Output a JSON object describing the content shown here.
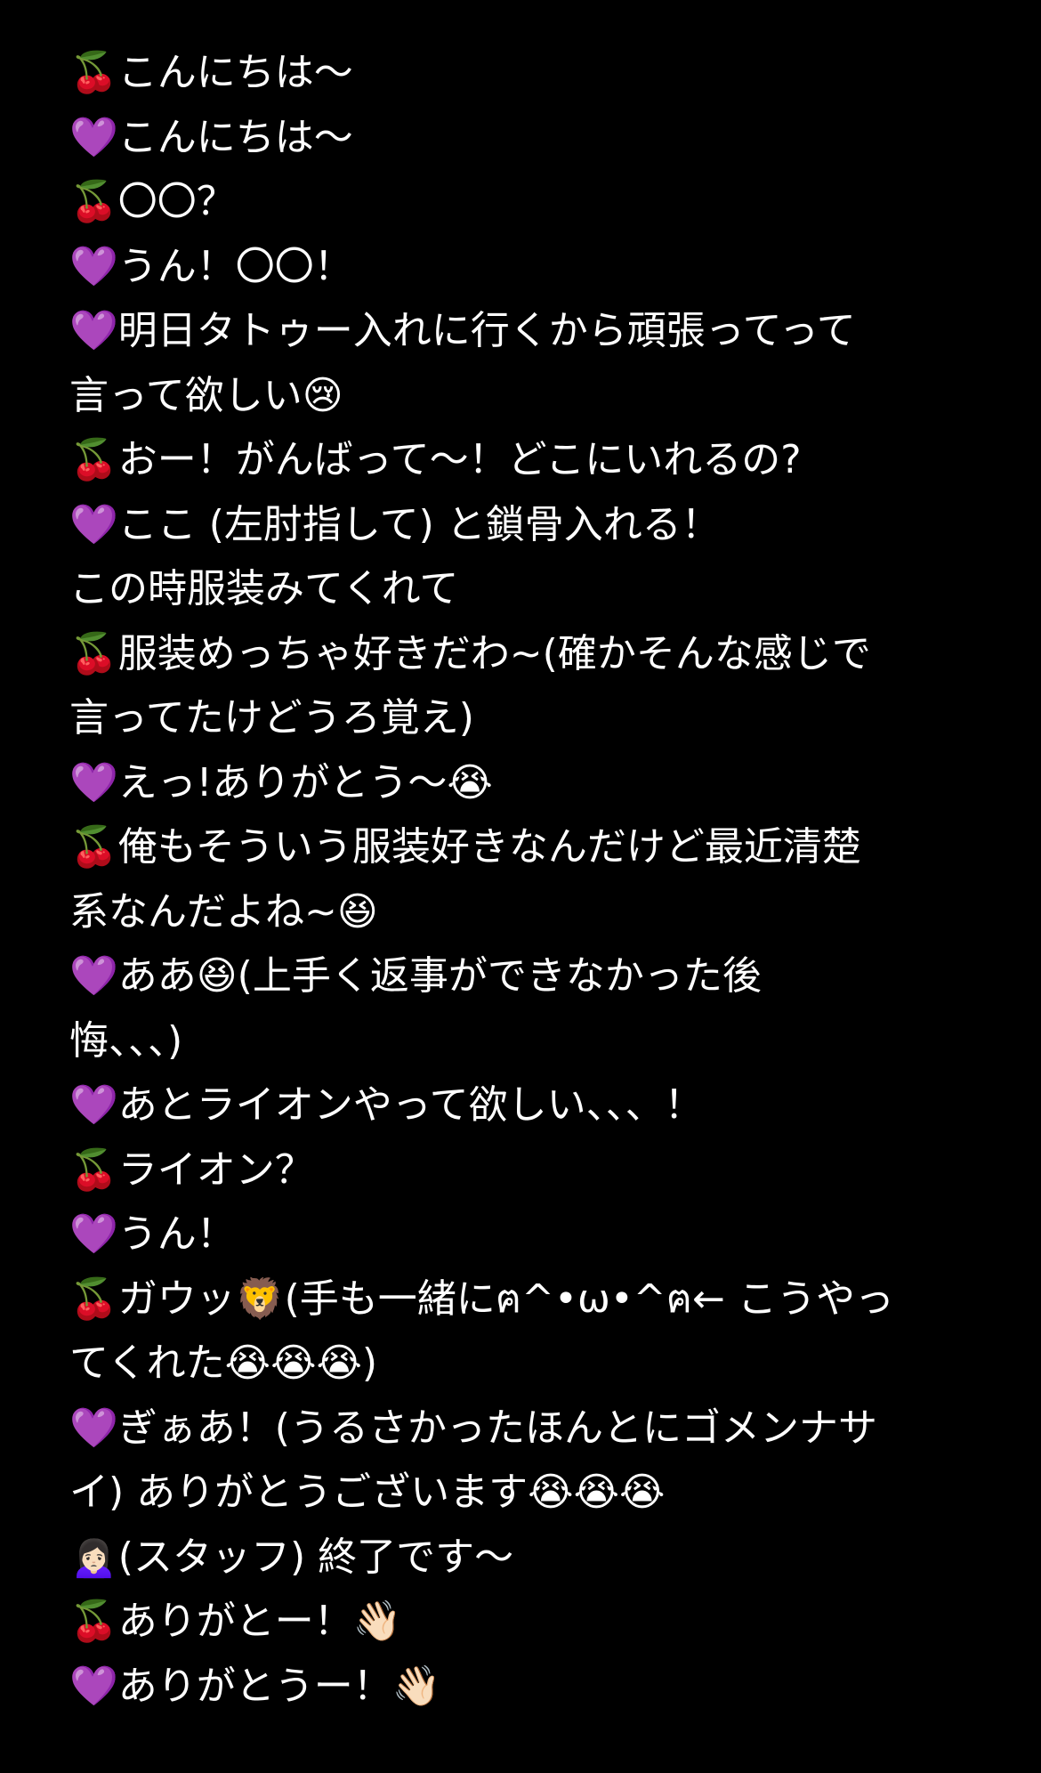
{
  "lines": [
    "🍒こんにちは〜",
    "💜こんにちは〜",
    "🍒〇〇？",
    "💜うん！〇〇！",
    "💜明日タトゥー入れに行くから頑張ってって",
    "言って欲しい😢",
    "🍒おー！がんばって～！どこにいれるの?",
    "💜ここ (左肘指して) と鎖骨入れる！",
    "この時服装みてくれて",
    "🍒服装めっちゃ好きだわ~(確かそんな感じで",
    "言ってたけどうろ覚え)",
    "💜えっ!ありがとう〜😭",
    "🍒俺もそういう服装好きなんだけど最近清楚",
    "系なんだよね~😆",
    "💜ああ😆(上手く返事ができなかった後",
    "悔、、、)",
    "💜あとライオンやって欲しい、、、！",
    "🍒ライオン？",
    "💜うん！",
    "🍒ガウッ🦁(手も一緒にฅ^•ω•^ฅ← こうやっ",
    "てくれた😭😭😭)",
    "💜ぎぁあ！(うるさかったほんとにゴメンナサ",
    "イ) ありがとうございます😭😭😭",
    "🙍🏻‍♀️(スタッフ) 終了です〜",
    "🍒ありがとー！👋🏻",
    "💜ありがとうー！👋🏻"
  ]
}
